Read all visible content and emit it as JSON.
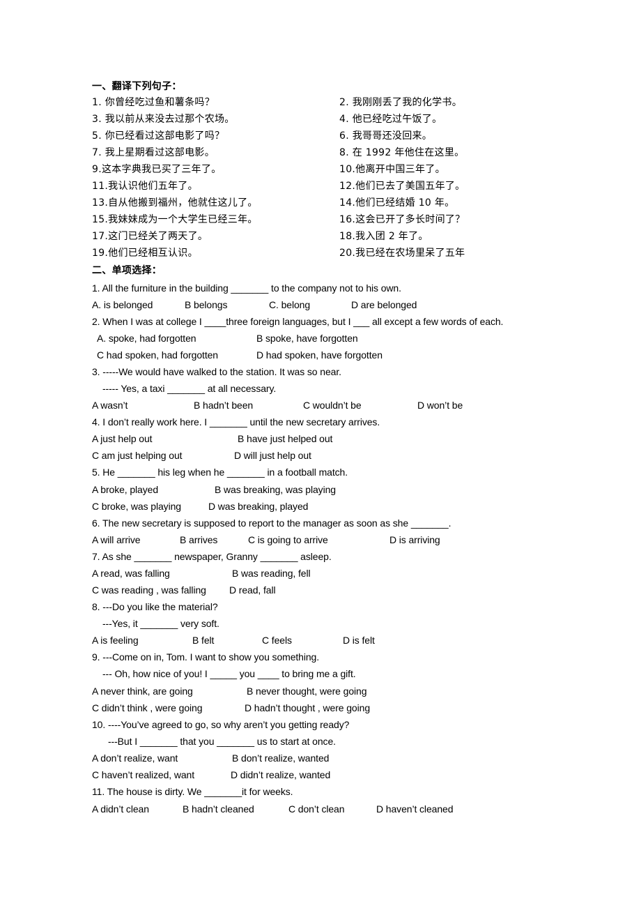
{
  "section1": {
    "heading": "一、翻译下列句子：",
    "items": [
      "1.  你曾经吃过鱼和薯条吗？",
      "2.  我刚刚丢了我的化学书。",
      "3.  我以前从来没去过那个农场。",
      "4.  他已经吃过午饭了。",
      "5.  你已经看过这部电影了吗？",
      "6.  我哥哥还没回来。",
      "7.  我上星期看过这部电影。",
      "8.  在 1992 年他住在这里。",
      "9.这本字典我已买了三年了。",
      "10.他离开中国三年了。",
      "11.我认识他们五年了。",
      "12.他们已去了美国五年了。",
      "13.自从他搬到福州，他就住这儿了。",
      "14.他们已经结婚 10 年。",
      "15.我妹妹成为一个大学生已经三年。",
      "16.这会已开了多长时间了？",
      "17.这门已经关了两天了。",
      "18.我入团 2 年了。",
      "19.他们已经相互认识。",
      "20.我已经在农场里呆了五年"
    ]
  },
  "section2": {
    "heading": "二、单项选择：",
    "questions": [
      {
        "lines": [
          "1.     All the furniture in the building _______ to the company not to his own."
        ],
        "options": [
          "A. is belonged",
          "B belongs",
          "C. belong",
          "D are belonged"
        ]
      },
      {
        "lines": [
          "2. When I was at college I ____three foreign languages, but I ___ all except a few words of each."
        ],
        "options": [
          "A. spoke, had forgotten",
          "B spoke, have forgotten",
          "C had spoken, had forgotten",
          "D had spoken, have forgotten"
        ]
      },
      {
        "lines": [
          "3. -----We would have walked to the station. It was so near.",
          "----- Yes, a taxi _______ at all necessary."
        ],
        "options": [
          "A wasn’t",
          "B hadn’t been",
          "C wouldn’t be",
          "D won’t be"
        ]
      },
      {
        "lines": [
          "4. I don’t really work here. I _______ until the new secretary arrives."
        ],
        "options": [
          "A just help out",
          "B have just helped out",
          "C am just helping out",
          "D will just help out"
        ]
      },
      {
        "lines": [
          "5. He _______ his leg when he _______ in a football match."
        ],
        "options": [
          "A broke, played",
          "B was breaking, was playing",
          "C broke, was playing",
          "D was breaking, played"
        ]
      },
      {
        "lines": [
          "6. The new secretary is supposed to report to the manager as soon as she _______."
        ],
        "options": [
          "A will arrive",
          "B arrives",
          "C is going to arrive",
          "D is arriving"
        ]
      },
      {
        "lines": [
          "7. As she _______ newspaper, Granny _______ asleep."
        ],
        "options": [
          "A read, was falling",
          "B was reading, fell",
          "C was reading , was falling",
          "D read, fall"
        ]
      },
      {
        "lines": [
          "8. ---Do you like the material?",
          "---Yes, it _______ very soft."
        ],
        "options": [
          "A is feeling",
          "B felt",
          "C feels",
          "D is felt"
        ]
      },
      {
        "lines": [
          "9. ---Come on in, Tom. I want to show you something.",
          "--- Oh, how nice of you! I _____ you ____ to bring me a gift."
        ],
        "options": [
          "A never think, are going",
          "B never thought, were going",
          "C didn’t think , were going",
          "D hadn’t thought , were going"
        ]
      },
      {
        "lines": [
          "10. ----You’ve agreed to go, so why aren’t you getting ready?",
          "---But I _______ that you _______ us to start at once."
        ],
        "options": [
          "A don’t realize, want",
          "B don’t realize, wanted",
          "C haven’t realized, want",
          "D didn’t realize, wanted"
        ]
      },
      {
        "lines": [
          "11. The house is dirty. We _______it for weeks."
        ],
        "options": [
          "A didn’t clean",
          "B hadn’t cleaned",
          "C don’t clean",
          "D haven’t cleaned"
        ]
      }
    ]
  }
}
